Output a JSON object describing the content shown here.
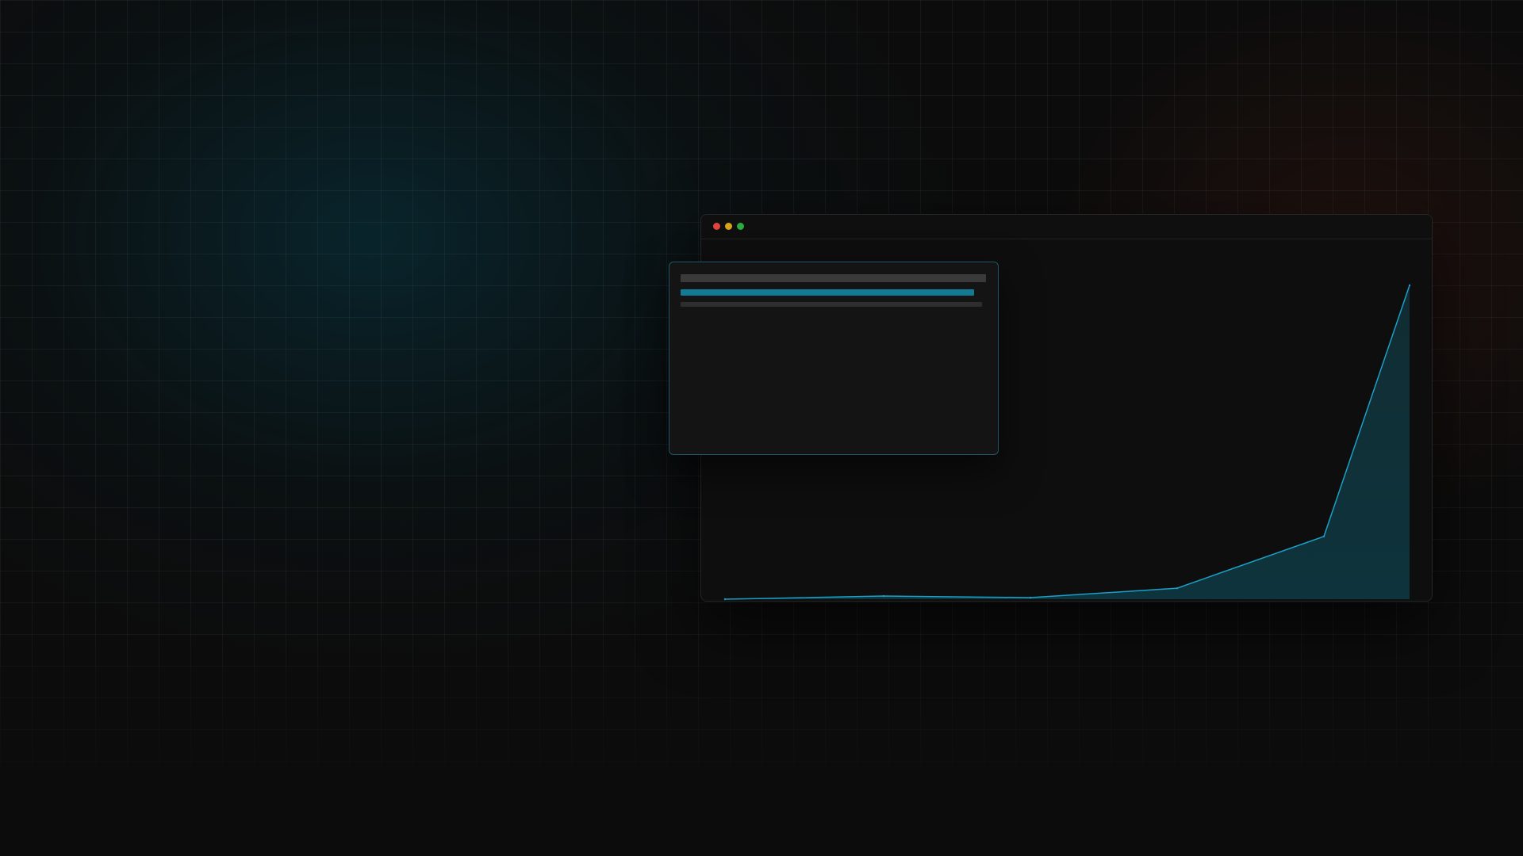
{
  "window": {
    "traffic_lights": {
      "close": "#e0443e",
      "minimize": "#d9a21b",
      "maximize": "#2aac3d"
    }
  },
  "panel": {
    "skeleton_lines": [
      {
        "role": "title-placeholder",
        "color": "#3a3a3a"
      },
      {
        "role": "highlight-placeholder",
        "color": "#127a92"
      },
      {
        "role": "text-placeholder",
        "color": "#2e2e2e"
      }
    ],
    "border_color": "#1f5566"
  },
  "chart_data": {
    "type": "area",
    "x": [
      0,
      1,
      2,
      3,
      4,
      5
    ],
    "values": [
      0,
      1,
      0.5,
      3.5,
      20,
      100
    ],
    "ylim": [
      0,
      100
    ],
    "grid": false,
    "line_color": "#1aa0c8",
    "fill_color": "#0e3a44"
  },
  "colors": {
    "background": "#0c0c0c",
    "accent": "#1aa0c8"
  }
}
